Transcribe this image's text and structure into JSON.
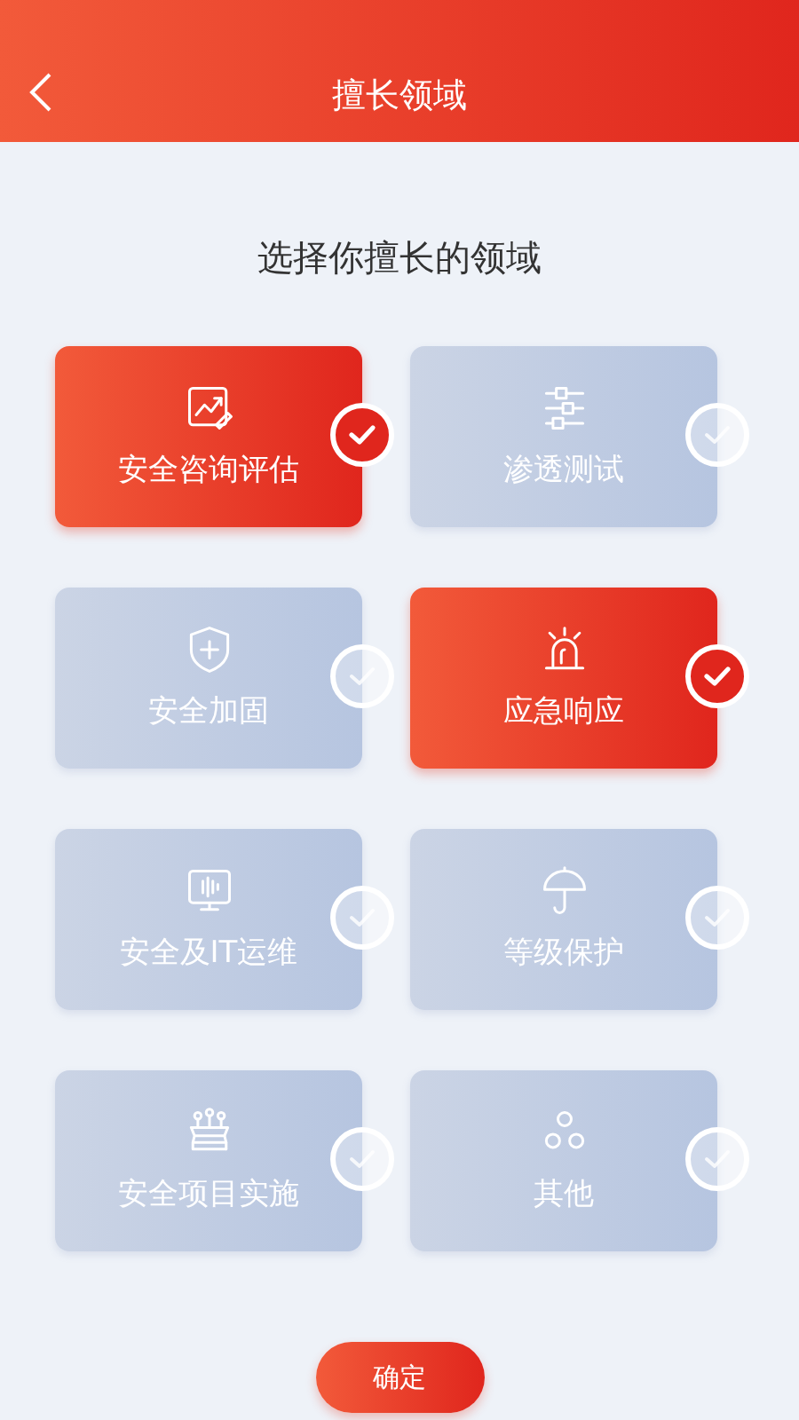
{
  "header": {
    "title": "擅长领域"
  },
  "heading": "选择你擅长的领域",
  "items": [
    {
      "label": "安全咨询评估",
      "selected": true
    },
    {
      "label": "渗透测试",
      "selected": false
    },
    {
      "label": "安全加固",
      "selected": false
    },
    {
      "label": "应急响应",
      "selected": true
    },
    {
      "label": "安全及IT运维",
      "selected": false
    },
    {
      "label": "等级保护",
      "selected": false
    },
    {
      "label": "安全项目实施",
      "selected": false
    },
    {
      "label": "其他",
      "selected": false
    }
  ],
  "confirm": "确定"
}
